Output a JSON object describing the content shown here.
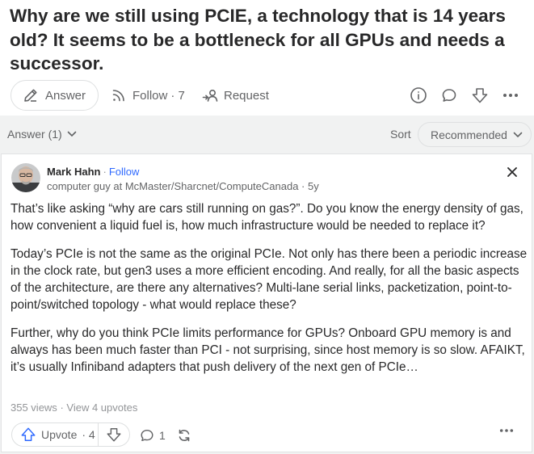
{
  "question": {
    "title": "Why are we still using PCIE, a technology that is 14 years old? It seems to be a bottleneck for all GPUs and needs a successor.",
    "actions": {
      "answer_label": "Answer",
      "follow_label": "Follow",
      "follow_count": "· 7",
      "request_label": "Request"
    }
  },
  "answers_bar": {
    "answer_count_label": "Answer (1)",
    "sort_label": "Sort",
    "sort_value": "Recommended"
  },
  "answer": {
    "author_name": "Mark Hahn",
    "separator": "·",
    "follow_label": "Follow",
    "credential": "computer guy at McMaster/Sharcnet/ComputeCanada · 5y",
    "paragraphs": [
      "That’s like asking “why are cars still running on gas?”. Do you know the energy density of gas, how convenient a liquid fuel is, how much infrastructure would be needed to replace it?",
      "Today’s PCIe is not the same as the original PCIe. Not only has there been a periodic increase in the clock rate, but gen3 uses a more efficient encoding. And really, for all the basic aspects of the architecture, are there any alternatives? Multi-lane serial links, packetization, point-to-point/switched topology - what would replace these?",
      "Further, why do you think PCIe limits performance for GPUs? Onboard GPU memory is and always has been much faster than PCI - not surprising, since host memory is so slow. AFAIKT, it’s usually Infiniband adapters that push delivery of the next gen of PCIe…"
    ],
    "views": "355 views",
    "stats_separator": "·",
    "upvotes_link": "View 4 upvotes",
    "upvote_label": "Upvote",
    "upvote_count": "· 4",
    "comment_count": "1"
  },
  "colors": {
    "accent_blue": "#2e69ff",
    "text_primary": "#282829",
    "text_secondary": "#636466",
    "page_background": "#f1f2f2"
  },
  "icons": [
    "pencil-icon",
    "follow-signal-icon",
    "request-person-icon",
    "info-icon",
    "comment-icon",
    "downvote-icon",
    "more-icon",
    "chevron-down-icon",
    "close-icon",
    "upvote-icon",
    "share-icon"
  ]
}
